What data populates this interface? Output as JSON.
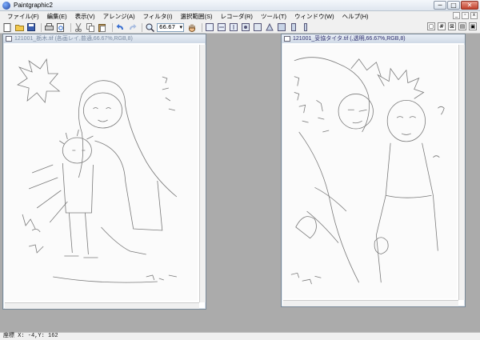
{
  "app": {
    "title": "Paintgraphic2"
  },
  "window_controls": {
    "minimize": "─",
    "maximize": "□",
    "close": "✕"
  },
  "menu": {
    "items": [
      "ファイル(F)",
      "編集(E)",
      "表示(V)",
      "アレンジ(A)",
      "フィルタ(I)",
      "選択範囲(S)",
      "レコーダ(R)",
      "ツール(T)",
      "ウィンドウ(W)",
      "ヘルプ(H)"
    ]
  },
  "toolbar": {
    "zoom_value": "66.67",
    "icons": [
      "new-icon",
      "open-icon",
      "save-icon",
      "print-icon",
      "print-preview-icon",
      "cut-icon",
      "copy-icon",
      "paste-icon",
      "undo-icon",
      "redo-icon",
      "zoom-icon",
      "hand-icon"
    ]
  },
  "documents": [
    {
      "title": "121001_栃木.tif (各画レイ,普通,66.67%,RGB,8)",
      "active": false
    },
    {
      "title": "121001_妥協タイタ.tif (,透明,66.67%,RGB,8)",
      "active": true
    }
  ],
  "statusbar": {
    "text": "座標 X:  -4,Y: 162"
  },
  "colors": {
    "workspace": "#ababab",
    "chrome": "#f0f0f0",
    "title_text_active": "#2a2a6a",
    "title_text_inactive": "#7a8aa0"
  }
}
